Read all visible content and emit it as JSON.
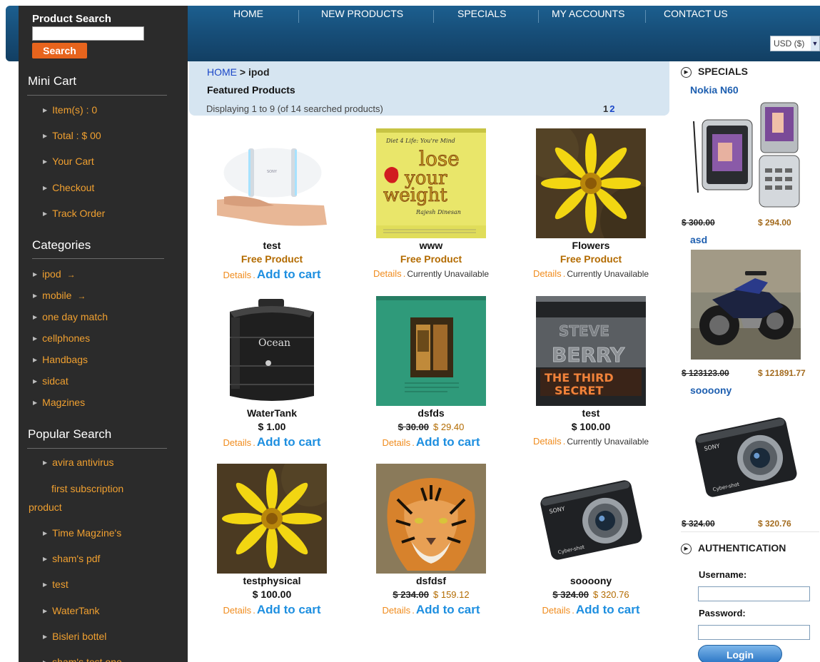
{
  "search": {
    "title": "Product Search",
    "button": "Search"
  },
  "nav": [
    "HOME",
    "NEW PRODUCTS",
    "SPECIALS",
    "MY ACCOUNTS",
    "CONTACT US"
  ],
  "currency": "USD ($)",
  "minicart": {
    "title": "Mini Cart",
    "items": [
      "Item(s) : 0",
      "Total : $ 00",
      "Your Cart",
      "Checkout",
      "Track Order"
    ]
  },
  "categories": {
    "title": "Categories",
    "items": [
      "ipod",
      "mobile",
      "one day match",
      "cellphones",
      "Handbags",
      "sidcat",
      "Magzines"
    ]
  },
  "popular": {
    "title": "Popular Search",
    "items": [
      "avira antivirus",
      "first subscription",
      "product",
      "Time Magzine's",
      "sham's pdf",
      "test",
      "WaterTank",
      "Bisleri bottel",
      "sham's test one"
    ]
  },
  "breadcrumb": {
    "home": "HOME",
    "sep": ">",
    "current": "ipod"
  },
  "featured_title": "Featured Products",
  "displaying": "Displaying 1 to 9 (of 14 searched products)",
  "pager": {
    "p1": "1",
    "p2": "2"
  },
  "labels": {
    "details": "Details",
    "dot": ".",
    "add_to_cart": "Add to cart",
    "unavailable": "Currently Unavailable",
    "free": "Free Product"
  },
  "products": [
    {
      "name": "test",
      "price": "Free Product"
    },
    {
      "name": "www",
      "price": "Free Product"
    },
    {
      "name": "Flowers",
      "price": "Free Product"
    },
    {
      "name": "WaterTank",
      "price": "$ 1.00"
    },
    {
      "name": "dsfds",
      "old": "$ 30.00",
      "new": "$ 29.40"
    },
    {
      "name": "test",
      "price": "$ 100.00"
    },
    {
      "name": "testphysical",
      "price": "$ 100.00"
    },
    {
      "name": "dsfdsf",
      "old": "$ 234.00",
      "new": "$ 159.12"
    },
    {
      "name": "soooony",
      "old": "$ 324.00",
      "new": "$ 320.76"
    }
  ],
  "book": {
    "small": "Diet 4 Life: You're Mind",
    "l1": "lose",
    "l2": "your",
    "l3": "weight",
    "author": "Rajesh Dinesan"
  },
  "tank_brand": "Ocean",
  "steve": {
    "l1": "STEVE",
    "l2": "BERRY",
    "l3": "THE THIRD",
    "l4": "SECRET"
  },
  "camera": {
    "brand": "SONY",
    "model": "Cyber-shot"
  },
  "specials": {
    "title": "SPECIALS",
    "items": [
      {
        "name": "Nokia N60",
        "old": "$ 300.00",
        "new": "$ 294.00"
      },
      {
        "name": "asd",
        "old": "$ 123123.00",
        "new": "$ 121891.77"
      },
      {
        "name": "soooony",
        "old": "$ 324.00",
        "new": "$ 320.76"
      }
    ]
  },
  "auth": {
    "title": "AUTHENTICATION",
    "username": "Username:",
    "password": "Password:",
    "login": "Login"
  }
}
